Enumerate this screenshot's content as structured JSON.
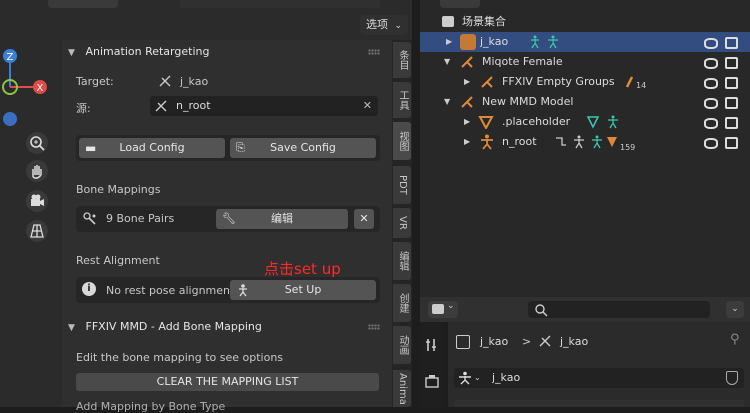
{
  "header": {
    "options_label": "选项"
  },
  "retarget": {
    "title": "Animation Retargeting",
    "target_label": "Target:",
    "target_value": "j_kao",
    "source_label": "源:",
    "source_value": "n_root",
    "load_config": "Load Config",
    "save_config": "Save Config",
    "bone_mappings_label": "Bone Mappings",
    "bone_pairs": "9 Bone Pairs",
    "edit_label": "编辑",
    "rest_alignment_label": "Rest Alignment",
    "rest_status": "No rest pose alignment",
    "setup_label": "Set Up",
    "annotation": "点击set up"
  },
  "bone_mapping": {
    "title": "FFXIV MMD - Add Bone Mapping",
    "hint": "Edit the bone mapping to see options",
    "clear_label": "CLEAR THE MAPPING LIST",
    "cut_text": "Add Mapping by Bone Type"
  },
  "side_tabs": [
    "条目",
    "工具",
    "视图",
    "PDT",
    "VR",
    "编辑",
    "创建",
    "动画",
    "Anima"
  ],
  "outliner": {
    "collection": "场景集合",
    "rows": [
      {
        "name": "j_kao",
        "selected": true
      },
      {
        "name": "Miqote Female"
      },
      {
        "name": "FFXIV Empty Groups",
        "badge": "14"
      },
      {
        "name": "New MMD Model"
      },
      {
        "name": ".placeholder"
      },
      {
        "name": "n_root",
        "badge": "159"
      }
    ]
  },
  "properties": {
    "breadcrumb_1": "j_kao",
    "breadcrumb_sep": ">",
    "breadcrumb_2": "j_kao",
    "name_value": "j_kao"
  },
  "colors": {
    "axis_y": "#8cc63f",
    "axis_x": "#e04b4b",
    "axis_z": "#3a7fd9",
    "armature": "#e08a38",
    "bone_teal": "#3cc9b0",
    "selected_row": "#334d80",
    "annotation": "#ff2a2a"
  }
}
